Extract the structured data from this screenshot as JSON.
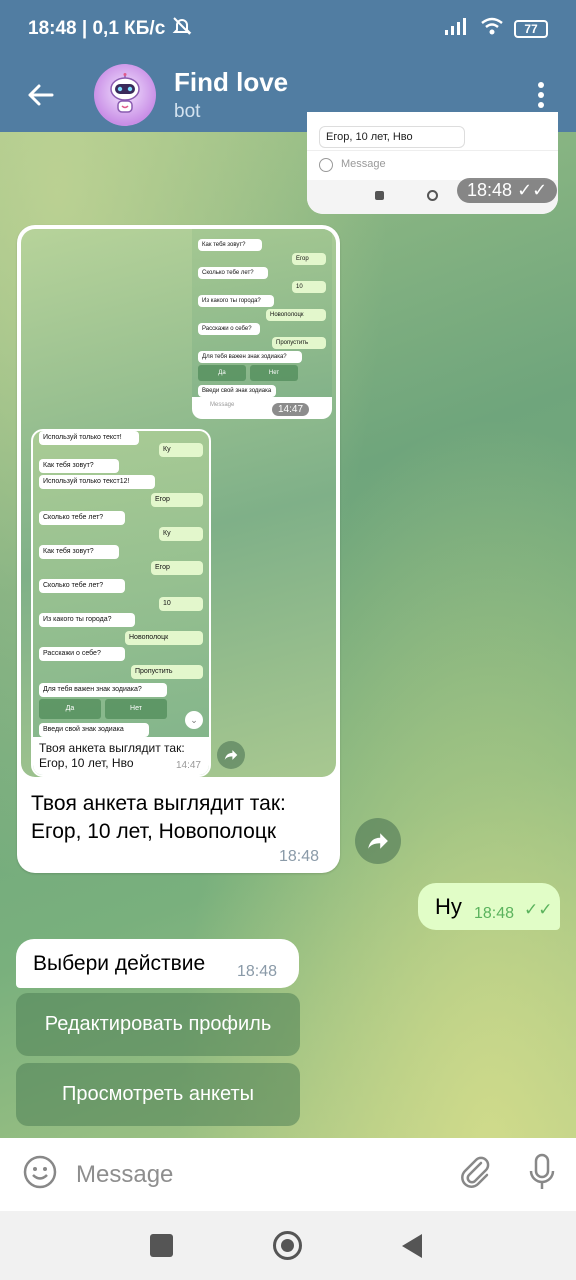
{
  "status_bar": {
    "time_speed": "18:48 | 0,1 КБ/с",
    "battery": "77"
  },
  "header": {
    "title": "Find love",
    "subtitle": "bot"
  },
  "top_screenshot": {
    "message_text": "Егор, 10 лет, Нво",
    "input_placeholder": "Message",
    "time": "18:48"
  },
  "forwarded_screenshot": {
    "inner_screenshot_1": {
      "messages": [
        {
          "dir": "in",
          "text": "Как тебя зовут?"
        },
        {
          "dir": "out",
          "text": "Егор"
        },
        {
          "dir": "in",
          "text": "Сколько тебе лет?"
        },
        {
          "dir": "out",
          "text": "10"
        },
        {
          "dir": "in",
          "text": "Из какого ты города?"
        },
        {
          "dir": "out",
          "text": "Новополоцк"
        },
        {
          "dir": "in",
          "text": "Расскажи о себе?"
        },
        {
          "dir": "out",
          "text": "Пропустить"
        },
        {
          "dir": "in",
          "text": "Для тебя важен знак зодиака?"
        }
      ],
      "kb_yes": "Да",
      "kb_no": "Нет",
      "last_prompt": "Введи свой знак зодиака",
      "input_placeholder": "Message",
      "time": "14:47"
    },
    "inner_screenshot_2": {
      "messages": [
        {
          "dir": "in",
          "text": "Используй только текст!"
        },
        {
          "dir": "out",
          "text": "Ку"
        },
        {
          "dir": "in",
          "text": "Как тебя зовут?"
        },
        {
          "dir": "in",
          "text": "Используй только текст12!"
        },
        {
          "dir": "out",
          "text": "Егор"
        },
        {
          "dir": "in",
          "text": "Сколько тебе лет?"
        },
        {
          "dir": "out",
          "text": "Ку"
        },
        {
          "dir": "in",
          "text": "Как тебя зовут?"
        },
        {
          "dir": "out",
          "text": "Егор"
        },
        {
          "dir": "in",
          "text": "Сколько тебе лет?"
        },
        {
          "dir": "out",
          "text": "10"
        },
        {
          "dir": "in",
          "text": "Из какого ты города?"
        },
        {
          "dir": "out",
          "text": "Новополоцк"
        },
        {
          "dir": "in",
          "text": "Расскажи о себе?"
        },
        {
          "dir": "out",
          "text": "Пропустить"
        },
        {
          "dir": "in",
          "text": "Для тебя важен знак зодиака?"
        }
      ],
      "kb_yes": "Да",
      "kb_no": "Нет",
      "last_prompt": "Введи свой знак зодиака",
      "caption_line1": "Твоя анкета выглядит так:",
      "caption_line2": "Егор, 10 лет, Нво",
      "time": "14:47"
    },
    "caption_line1": "Твоя анкета выглядит так:",
    "caption_line2": "Егор, 10 лет, Новополоцк",
    "time": "18:48"
  },
  "outgoing_message": {
    "text": "Ну",
    "time": "18:48"
  },
  "incoming_message": {
    "text": "Выбери действие",
    "time": "18:48"
  },
  "bot_keyboard": {
    "button1": "Редактировать профиль",
    "button2": "Просмотреть анкеты"
  },
  "composer": {
    "placeholder": "Message"
  },
  "colors": {
    "header": "#517da2",
    "outgoing_bubble": "#e1fdc7",
    "read_check": "#5bb35d"
  }
}
